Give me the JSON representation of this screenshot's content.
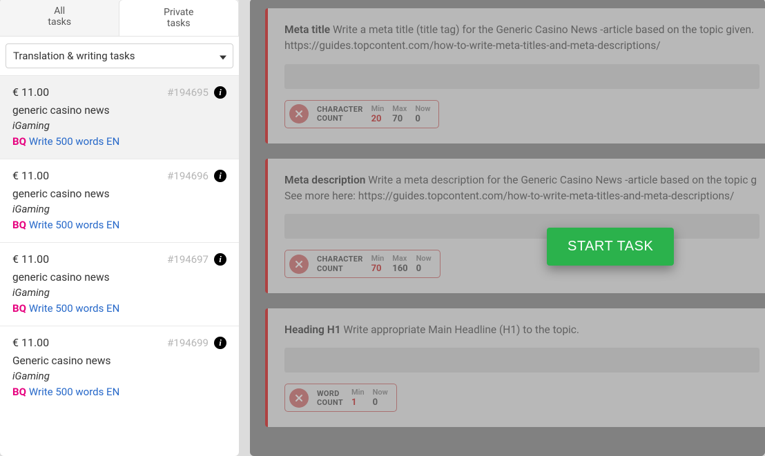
{
  "tabs": {
    "all": "All\ntasks",
    "private": "Private\ntasks"
  },
  "dropdown": {
    "selected": "Translation & writing tasks"
  },
  "tasks": [
    {
      "price": "€ 11.00",
      "id": "#194695",
      "title": "generic casino news",
      "category": "iGaming",
      "bq": "BQ",
      "link": "Write 500 words EN",
      "selected": true
    },
    {
      "price": "€ 11.00",
      "id": "#194696",
      "title": "generic casino news",
      "category": "iGaming",
      "bq": "BQ",
      "link": "Write 500 words EN",
      "selected": false
    },
    {
      "price": "€ 11.00",
      "id": "#194697",
      "title": "generic casino news",
      "category": "iGaming",
      "bq": "BQ",
      "link": "Write 500 words EN",
      "selected": false
    },
    {
      "price": "€ 11.00",
      "id": "#194699",
      "title": "Generic casino news",
      "category": "iGaming",
      "bq": "BQ",
      "link": "Write 500 words EN",
      "selected": false
    }
  ],
  "cards": [
    {
      "heading": "Meta title",
      "body": "Write a meta title (title tag) for the Generic Casino News -article based on the topic given. https://guides.topcontent.com/how-to-write-meta-titles-and-meta-descriptions/",
      "counter": {
        "label1": "CHARACTER",
        "label2": "COUNT",
        "cols": [
          {
            "h": "Min",
            "v": "20",
            "red": true
          },
          {
            "h": "Max",
            "v": "70"
          },
          {
            "h": "Now",
            "v": "0"
          }
        ]
      }
    },
    {
      "heading": "Meta description",
      "body": "Write a meta description for the Generic Casino News -article based on the topic g See more here: https://guides.topcontent.com/how-to-write-meta-titles-and-meta-descriptions/",
      "counter": {
        "label1": "CHARACTER",
        "label2": "COUNT",
        "cols": [
          {
            "h": "Min",
            "v": "70",
            "red": true
          },
          {
            "h": "Max",
            "v": "160"
          },
          {
            "h": "Now",
            "v": "0"
          }
        ]
      }
    },
    {
      "heading": "Heading H1",
      "body": "Write appropriate Main Headline (H1) to the topic.",
      "counter": {
        "label1": "WORD",
        "label2": "COUNT",
        "cols": [
          {
            "h": "Min",
            "v": "1",
            "red": true
          },
          {
            "h": "Now",
            "v": "0"
          }
        ]
      }
    }
  ],
  "start_button": "START TASK"
}
